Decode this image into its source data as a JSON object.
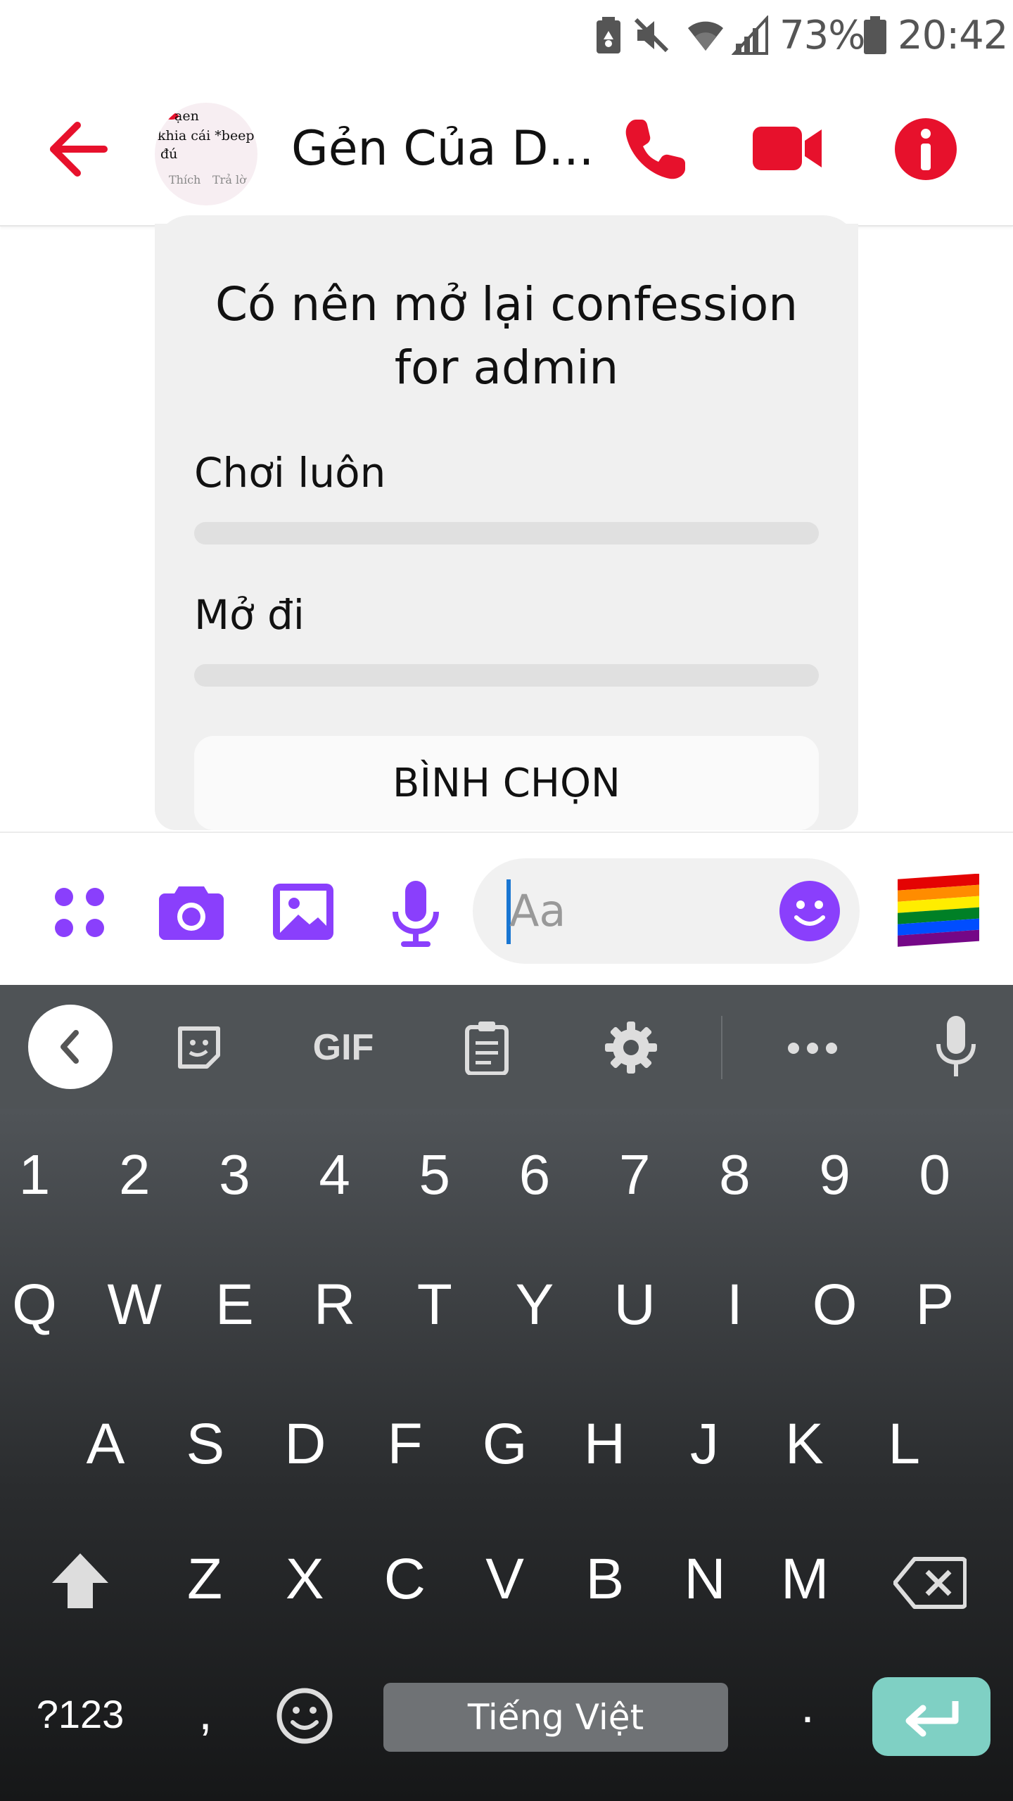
{
  "status_bar": {
    "battery_percent": "73%",
    "time": "20:42"
  },
  "header": {
    "title": "Gẻn Của D...",
    "avatar_text": [
      "ạen",
      "khia cái *beep*",
      "đú",
      "Thích",
      "Trả lờ"
    ]
  },
  "poll": {
    "question": "Có nên mở lại confession for admin",
    "options": [
      {
        "label": "Chơi luôn",
        "fraction": 0
      },
      {
        "label": "Mở đi",
        "fraction": 0
      }
    ],
    "vote_label": "BÌNH CHỌN"
  },
  "composer": {
    "placeholder": "Aa"
  },
  "keyboard": {
    "toolbar": {
      "gif_label": "GIF"
    },
    "numbers": [
      "1",
      "2",
      "3",
      "4",
      "5",
      "6",
      "7",
      "8",
      "9",
      "0"
    ],
    "row1": [
      "Q",
      "W",
      "E",
      "R",
      "T",
      "Y",
      "U",
      "I",
      "O",
      "P"
    ],
    "row2": [
      "A",
      "S",
      "D",
      "F",
      "G",
      "H",
      "J",
      "K",
      "L"
    ],
    "row3": [
      "Z",
      "X",
      "C",
      "V",
      "B",
      "N",
      "M"
    ],
    "symbols_label": "?123",
    "comma": ",",
    "period": ".",
    "space_label": "Tiếng Việt"
  },
  "colors": {
    "header_accent": "#e7112c",
    "composer_accent": "#8a3ffc",
    "enter_key": "#7fd0c4"
  }
}
